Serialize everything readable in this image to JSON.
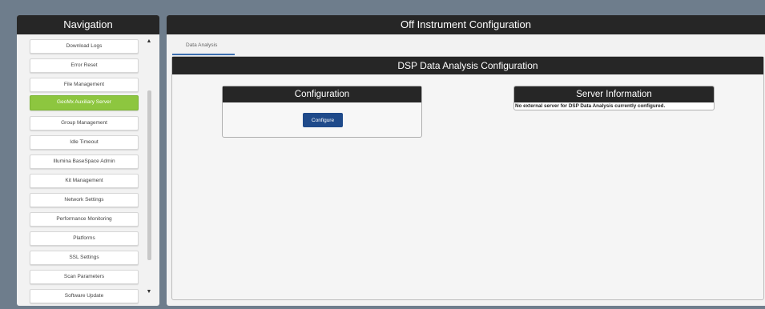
{
  "navigation": {
    "title": "Navigation",
    "items": [
      {
        "label": "Download Logs",
        "active": false
      },
      {
        "label": "Error Reset",
        "active": false
      },
      {
        "label": "File Management",
        "active": false
      },
      {
        "label": "GeoMx Auxiliary Server",
        "active": true
      },
      {
        "label": "Group Management",
        "active": false
      },
      {
        "label": "Idle Timeout",
        "active": false
      },
      {
        "label": "Illumina BaseSpace Admin",
        "active": false
      },
      {
        "label": "Kit Management",
        "active": false
      },
      {
        "label": "Network Settings",
        "active": false
      },
      {
        "label": "Performance Monitoring",
        "active": false
      },
      {
        "label": "Platforms",
        "active": false
      },
      {
        "label": "SSL Settings",
        "active": false
      },
      {
        "label": "Scan Parameters",
        "active": false
      },
      {
        "label": "Software Update",
        "active": false
      }
    ],
    "scroll_up_icon": "caret-up-icon",
    "scroll_down_icon": "caret-down-icon"
  },
  "main": {
    "title": "Off Instrument Configuration",
    "tabs": [
      {
        "label": "Data Analysis",
        "active": true
      }
    ],
    "panel_title": "DSP Data Analysis Configuration",
    "configuration": {
      "title": "Configuration",
      "button_label": "Configure"
    },
    "server_information": {
      "title": "Server Information",
      "message": "No external server for DSP Data Analysis currently configured."
    }
  },
  "colors": {
    "header_bg": "#262626",
    "active_nav": "#8dc63f",
    "button_primary": "#1f4a8a",
    "tab_underline": "#3c6fb0"
  }
}
